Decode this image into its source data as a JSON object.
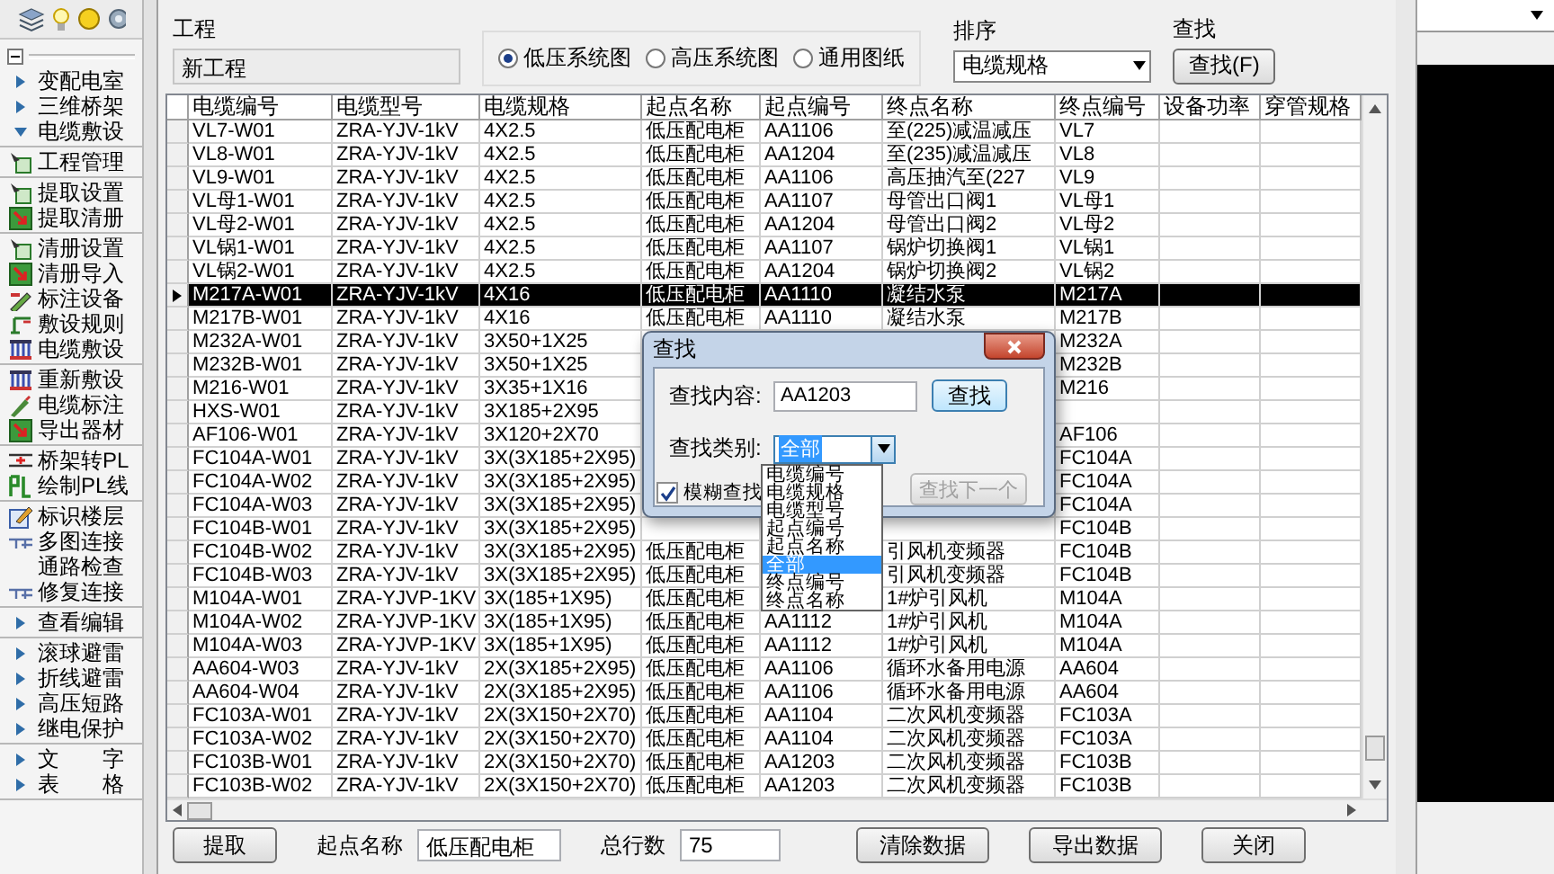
{
  "sidebar": {
    "groups": [
      {
        "items": [
          {
            "label": "变配电室",
            "kind": "collapsed"
          },
          {
            "label": "三维桥架",
            "kind": "collapsed"
          },
          {
            "label": "电缆敷设",
            "kind": "expanded"
          }
        ]
      },
      {
        "items": [
          {
            "label": "工程管理",
            "kind": "setup"
          }
        ]
      },
      {
        "items": [
          {
            "label": "提取设置",
            "kind": "setup"
          },
          {
            "label": "提取清册",
            "kind": "import"
          }
        ]
      },
      {
        "items": [
          {
            "label": "清册设置",
            "kind": "setup"
          },
          {
            "label": "清册导入",
            "kind": "import"
          },
          {
            "label": "标注设备",
            "kind": "mark"
          },
          {
            "label": "敷设规则",
            "kind": "rule"
          },
          {
            "label": "电缆敷设",
            "kind": "cable"
          }
        ]
      },
      {
        "items": [
          {
            "label": "重新敷设",
            "kind": "cable"
          },
          {
            "label": "电缆标注",
            "kind": "pen"
          },
          {
            "label": "导出器材",
            "kind": "import"
          }
        ]
      },
      {
        "items": [
          {
            "label": "桥架转PL",
            "kind": "tray"
          },
          {
            "label": "绘制PL线",
            "kind": "pl"
          }
        ]
      },
      {
        "items": [
          {
            "label": "标识楼层",
            "kind": "floor"
          },
          {
            "label": "多图连接",
            "kind": "link"
          },
          {
            "label": "通路检查",
            "kind": "none"
          },
          {
            "label": "修复连接",
            "kind": "link"
          }
        ]
      },
      {
        "items": [
          {
            "label": "查看编辑",
            "kind": "collapsed"
          }
        ]
      },
      {
        "items": [
          {
            "label": "滚球避雷",
            "kind": "collapsed"
          },
          {
            "label": "折线避雷",
            "kind": "collapsed"
          },
          {
            "label": "高压短路",
            "kind": "collapsed"
          },
          {
            "label": "继电保护",
            "kind": "collapsed"
          }
        ]
      },
      {
        "items": [
          {
            "label": "文　　字",
            "kind": "collapsed"
          },
          {
            "label": "表　　格",
            "kind": "collapsed"
          }
        ]
      }
    ]
  },
  "project": {
    "label": "工程",
    "value": "新工程"
  },
  "diagram_types": [
    {
      "label": "低压系统图",
      "selected": true
    },
    {
      "label": "高压系统图",
      "selected": false
    },
    {
      "label": "通用图纸",
      "selected": false
    }
  ],
  "sort": {
    "label": "排序",
    "value": "电缆规格"
  },
  "search": {
    "label": "查找",
    "button": "查找(F)"
  },
  "table": {
    "columns": [
      "电缆编号",
      "电缆型号",
      "电缆规格",
      "起点名称",
      "起点编号",
      "终点名称",
      "终点编号",
      "设备功率",
      "穿管规格"
    ],
    "rows": [
      {
        "selected": false,
        "cells": [
          "VL7-W01",
          "ZRA-YJV-1kV",
          "4X2.5",
          "低压配电柜",
          "AA1106",
          "至(225)减温减压",
          "VL7"
        ]
      },
      {
        "selected": false,
        "cells": [
          "VL8-W01",
          "ZRA-YJV-1kV",
          "4X2.5",
          "低压配电柜",
          "AA1204",
          "至(235)减温减压",
          "VL8"
        ]
      },
      {
        "selected": false,
        "cells": [
          "VL9-W01",
          "ZRA-YJV-1kV",
          "4X2.5",
          "低压配电柜",
          "AA1106",
          "高压抽汽至(227",
          "VL9"
        ]
      },
      {
        "selected": false,
        "cells": [
          "VL母1-W01",
          "ZRA-YJV-1kV",
          "4X2.5",
          "低压配电柜",
          "AA1107",
          "母管出口阀1",
          "VL母1"
        ]
      },
      {
        "selected": false,
        "cells": [
          "VL母2-W01",
          "ZRA-YJV-1kV",
          "4X2.5",
          "低压配电柜",
          "AA1204",
          "母管出口阀2",
          "VL母2"
        ]
      },
      {
        "selected": false,
        "cells": [
          "VL锅1-W01",
          "ZRA-YJV-1kV",
          "4X2.5",
          "低压配电柜",
          "AA1107",
          "锅炉切换阀1",
          "VL锅1"
        ]
      },
      {
        "selected": false,
        "cells": [
          "VL锅2-W01",
          "ZRA-YJV-1kV",
          "4X2.5",
          "低压配电柜",
          "AA1204",
          "锅炉切换阀2",
          "VL锅2"
        ]
      },
      {
        "selected": true,
        "cells": [
          "M217A-W01",
          "ZRA-YJV-1kV",
          "4X16",
          "低压配电柜",
          "AA1110",
          "凝结水泵",
          "M217A"
        ]
      },
      {
        "selected": false,
        "cells": [
          "M217B-W01",
          "ZRA-YJV-1kV",
          "4X16",
          "低压配电柜",
          "AA1110",
          "凝结水泵",
          "M217B"
        ]
      },
      {
        "selected": false,
        "cells": [
          "M232A-W01",
          "ZRA-YJV-1kV",
          "3X50+1X25",
          null,
          null,
          null,
          "M232A"
        ]
      },
      {
        "selected": false,
        "cells": [
          "M232B-W01",
          "ZRA-YJV-1kV",
          "3X50+1X25",
          null,
          null,
          null,
          "M232B"
        ]
      },
      {
        "selected": false,
        "cells": [
          "M216-W01",
          "ZRA-YJV-1kV",
          "3X35+1X16",
          null,
          null,
          null,
          "M216"
        ]
      },
      {
        "selected": false,
        "cells": [
          "HXS-W01",
          "ZRA-YJV-1kV",
          "3X185+2X95",
          null,
          null,
          null,
          null
        ]
      },
      {
        "selected": false,
        "cells": [
          "AF106-W01",
          "ZRA-YJV-1kV",
          "3X120+2X70",
          null,
          null,
          null,
          "AF106"
        ]
      },
      {
        "selected": false,
        "cells": [
          "FC104A-W01",
          "ZRA-YJV-1kV",
          "3X(3X185+2X95)",
          null,
          null,
          null,
          "FC104A"
        ]
      },
      {
        "selected": false,
        "cells": [
          "FC104A-W02",
          "ZRA-YJV-1kV",
          "3X(3X185+2X95)",
          null,
          null,
          null,
          "FC104A"
        ]
      },
      {
        "selected": false,
        "cells": [
          "FC104A-W03",
          "ZRA-YJV-1kV",
          "3X(3X185+2X95)",
          null,
          null,
          null,
          "FC104A"
        ]
      },
      {
        "selected": false,
        "cells": [
          "FC104B-W01",
          "ZRA-YJV-1kV",
          "3X(3X185+2X95)",
          null,
          null,
          null,
          "FC104B"
        ]
      },
      {
        "selected": false,
        "cells": [
          "FC104B-W02",
          "ZRA-YJV-1kV",
          "3X(3X185+2X95)",
          "低压配电柜",
          null,
          "引风机变频器",
          "FC104B"
        ]
      },
      {
        "selected": false,
        "cells": [
          "FC104B-W03",
          "ZRA-YJV-1kV",
          "3X(3X185+2X95)",
          "低压配电柜",
          null,
          "引风机变频器",
          "FC104B"
        ]
      },
      {
        "selected": false,
        "cells": [
          "M104A-W01",
          "ZRA-YJVP-1KV",
          "3X(185+1X95)",
          "低压配电柜",
          null,
          "1#炉引风机",
          "M104A"
        ]
      },
      {
        "selected": false,
        "cells": [
          "M104A-W02",
          "ZRA-YJVP-1KV",
          "3X(185+1X95)",
          "低压配电柜",
          "AA1112",
          "1#炉引风机",
          "M104A"
        ]
      },
      {
        "selected": false,
        "cells": [
          "M104A-W03",
          "ZRA-YJVP-1KV",
          "3X(185+1X95)",
          "低压配电柜",
          "AA1112",
          "1#炉引风机",
          "M104A"
        ]
      },
      {
        "selected": false,
        "cells": [
          "AA604-W03",
          "ZRA-YJV-1kV",
          "2X(3X185+2X95)",
          "低压配电柜",
          "AA1106",
          "循环水备用电源",
          "AA604"
        ]
      },
      {
        "selected": false,
        "cells": [
          "AA604-W04",
          "ZRA-YJV-1kV",
          "2X(3X185+2X95)",
          "低压配电柜",
          "AA1106",
          "循环水备用电源",
          "AA604"
        ]
      },
      {
        "selected": false,
        "cells": [
          "FC103A-W01",
          "ZRA-YJV-1kV",
          "2X(3X150+2X70)",
          "低压配电柜",
          "AA1104",
          "二次风机变频器",
          "FC103A"
        ]
      },
      {
        "selected": false,
        "cells": [
          "FC103A-W02",
          "ZRA-YJV-1kV",
          "2X(3X150+2X70)",
          "低压配电柜",
          "AA1104",
          "二次风机变频器",
          "FC103A"
        ]
      },
      {
        "selected": false,
        "cells": [
          "FC103B-W01",
          "ZRA-YJV-1kV",
          "2X(3X150+2X70)",
          "低压配电柜",
          "AA1203",
          "二次风机变频器",
          "FC103B"
        ]
      },
      {
        "selected": false,
        "cells": [
          "FC103B-W02",
          "ZRA-YJV-1kV",
          "2X(3X150+2X70)",
          "低压配电柜",
          "AA1203",
          "二次风机变频器",
          "FC103B"
        ]
      }
    ]
  },
  "find_dialog": {
    "title": "查找",
    "content_label": "查找内容:",
    "content_value": "AA1203",
    "find_button": "查找",
    "category_label": "查找类别:",
    "category_value": "全部",
    "category_options": [
      {
        "label": "电缆编号",
        "selected": false
      },
      {
        "label": "电缆规格",
        "selected": false
      },
      {
        "label": "电缆型号",
        "selected": false
      },
      {
        "label": "起点编号",
        "selected": false
      },
      {
        "label": "起点名称",
        "selected": false
      },
      {
        "label": "全部",
        "selected": true
      },
      {
        "label": "终点编号",
        "selected": false
      },
      {
        "label": "终点名称",
        "selected": false
      }
    ],
    "fuzzy_label": "模糊查找",
    "fuzzy_checked": true,
    "next_button": {
      "label": "查找下一个",
      "disabled": true
    }
  },
  "bottom_bar": {
    "extract_button": "提取",
    "start_label": "起点名称",
    "start_value": "低压配电柜",
    "count_label": "总行数",
    "count_value": "75",
    "clear_button": "清除数据",
    "export_button": "导出数据",
    "close_button": "关闭"
  }
}
